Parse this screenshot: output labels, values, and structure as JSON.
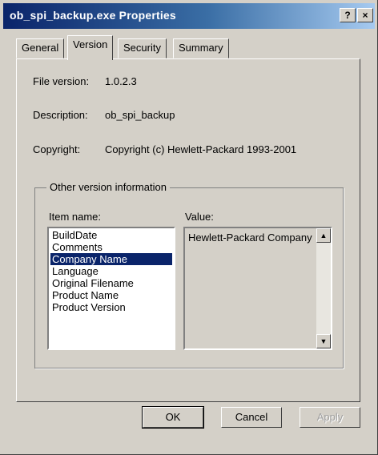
{
  "window": {
    "title": "ob_spi_backup.exe Properties",
    "help_label": "?",
    "close_label": "×"
  },
  "tabs": [
    {
      "label": "General"
    },
    {
      "label": "Version"
    },
    {
      "label": "Security"
    },
    {
      "label": "Summary"
    }
  ],
  "info": {
    "file_version_label": "File version:",
    "file_version_value": "1.0.2.3",
    "description_label": "Description:",
    "description_value": "ob_spi_backup",
    "copyright_label": "Copyright:",
    "copyright_value": "Copyright (c) Hewlett-Packard 1993-2001"
  },
  "other_info": {
    "group_title": "Other version information",
    "item_name_label": "Item name:",
    "value_label": "Value:",
    "items": [
      "BuildDate",
      "Comments",
      "Company Name",
      "Language",
      "Original Filename",
      "Product Name",
      "Product Version"
    ],
    "selected_item": "Company Name",
    "value": "Hewlett-Packard Company"
  },
  "buttons": {
    "ok": "OK",
    "cancel": "Cancel",
    "apply": "Apply"
  }
}
